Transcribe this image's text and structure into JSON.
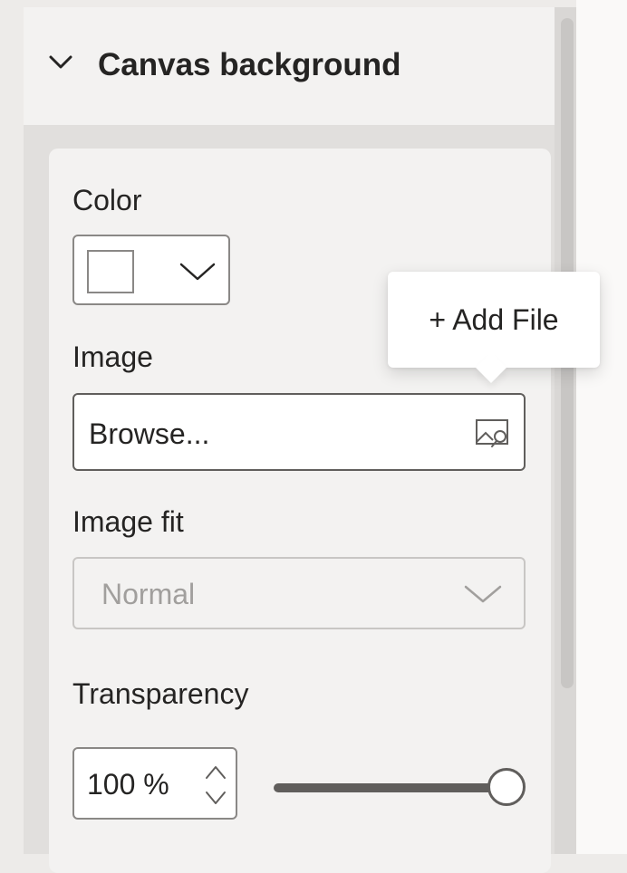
{
  "section": {
    "title": "Canvas background"
  },
  "color": {
    "label": "Color",
    "value_hex": "#ffffff"
  },
  "image": {
    "label": "Image",
    "input_value": "Browse...",
    "icon": "image-search-icon"
  },
  "tooltip": {
    "text": "+ Add File"
  },
  "image_fit": {
    "label": "Image fit",
    "selected": "Normal",
    "disabled": true
  },
  "transparency": {
    "label": "Transparency",
    "value_text": "100 %",
    "slider_percent": 100
  },
  "colors": {
    "pane": "#e1dfdd",
    "header": "#f3f2f1",
    "text": "#252423",
    "disabled_text": "#a19f9d",
    "border": "#8a8886"
  }
}
